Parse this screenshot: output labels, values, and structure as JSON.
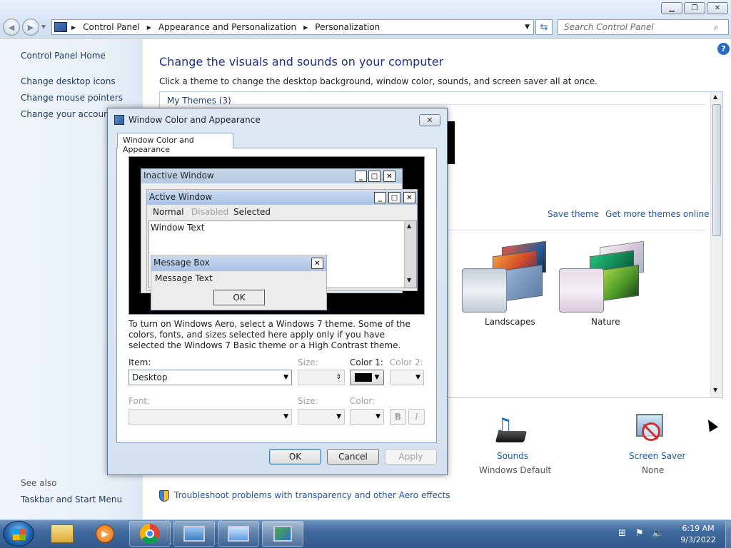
{
  "window": {
    "min": "▁",
    "max": "❐",
    "close": "✕"
  },
  "address": {
    "crumbs": [
      "Control Panel",
      "Appearance and Personalization",
      "Personalization"
    ],
    "search_placeholder": "Search Control Panel"
  },
  "sidebar": {
    "home": "Control Panel Home",
    "links": [
      "Change desktop icons",
      "Change mouse pointers",
      "Change your account p"
    ],
    "see_also": "See also",
    "taskbar": "Taskbar and Start Menu"
  },
  "main": {
    "title": "Change the visuals and sounds on your computer",
    "subtitle": "Click a theme to change the desktop background, window color, sounds, and screen saver all at once.",
    "my_themes": "My Themes (3)",
    "save_theme": "Save theme",
    "get_more": "Get more themes online",
    "theme_names": [
      "Landscapes",
      "Nature"
    ],
    "sounds_label": "Sounds",
    "sounds_value": "Windows Default",
    "screensaver_label": "Screen Saver",
    "screensaver_value": "None",
    "troubleshoot": "Troubleshoot problems with transparency and other Aero effects"
  },
  "dialog": {
    "title": "Window Color and Appearance",
    "tab": "Window Color and Appearance",
    "preview": {
      "inactive": "Inactive Window",
      "active": "Active Window",
      "menu": [
        "Normal",
        "Disabled",
        "Selected"
      ],
      "window_text": "Window Text",
      "message_box": "Message Box",
      "message_text": "Message Text",
      "ok": "OK"
    },
    "info": "To turn on Windows Aero, select a Windows 7 theme.  Some of the colors, fonts, and sizes selected here apply only if you have selected the Windows 7 Basic theme or a High Contrast theme.",
    "item_label": "Item:",
    "item_value": "Desktop",
    "size_label": "Size:",
    "color1_label": "Color 1:",
    "color2_label": "Color 2:",
    "font_label": "Font:",
    "size2_label": "Size:",
    "color_label": "Color:",
    "bold": "B",
    "italic": "I",
    "ok": "OK",
    "cancel": "Cancel",
    "apply": "Apply",
    "color1": "#000000"
  },
  "taskbar": {
    "time": "6:19 AM",
    "date": "9/3/2022"
  }
}
